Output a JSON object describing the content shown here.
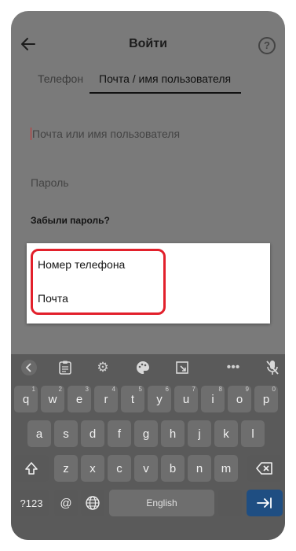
{
  "header": {
    "title": "Войти",
    "help_icon_text": "?"
  },
  "tabs": [
    {
      "label": "Телефон"
    },
    {
      "label": "Почта / имя пользователя"
    }
  ],
  "form": {
    "login_placeholder": "Почта или имя пользователя",
    "password_placeholder": "Пароль",
    "forgot_link": "Забыли пароль?"
  },
  "dropdown": {
    "options": [
      {
        "label": "Номер телефона"
      },
      {
        "label": "Почта"
      }
    ],
    "highlight_color": "#e2202b"
  },
  "keyboard": {
    "toolbar_icons": [
      "chevron-left-icon",
      "clipboard-icon",
      "gear-icon",
      "palette-icon",
      "resize-icon",
      "more-icon",
      "mic-off-icon"
    ],
    "row1": [
      {
        "key": "q",
        "hint": "1"
      },
      {
        "key": "w",
        "hint": "2"
      },
      {
        "key": "e",
        "hint": "3"
      },
      {
        "key": "r",
        "hint": "4"
      },
      {
        "key": "t",
        "hint": "5"
      },
      {
        "key": "y",
        "hint": "6"
      },
      {
        "key": "u",
        "hint": "7"
      },
      {
        "key": "i",
        "hint": "8"
      },
      {
        "key": "o",
        "hint": "9"
      },
      {
        "key": "p",
        "hint": "0"
      }
    ],
    "row2": [
      "a",
      "s",
      "d",
      "f",
      "g",
      "h",
      "j",
      "k",
      "l"
    ],
    "row3": [
      "z",
      "x",
      "c",
      "v",
      "b",
      "n",
      "m"
    ],
    "bottom": {
      "numbers_key": "?123",
      "at_key": "@",
      "space_label": "English"
    },
    "accent_color": "#1f4e82"
  }
}
